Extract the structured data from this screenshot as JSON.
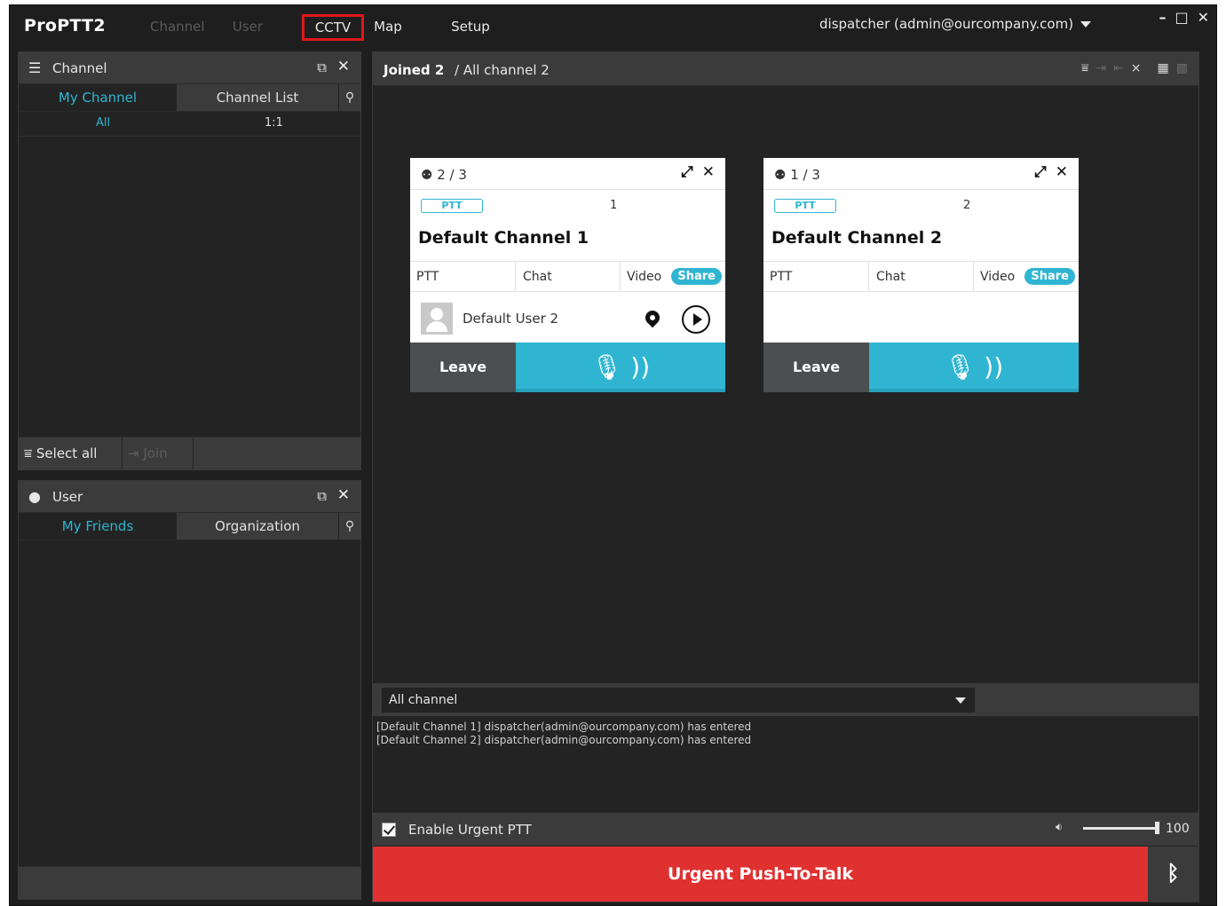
{
  "app": {
    "logo": "ProPTT2",
    "nav": {
      "channel": "Channel",
      "user": "User",
      "cctv": "CCTV",
      "map": "Map",
      "setup": "Setup"
    },
    "account": "dispatcher (admin@ourcompany.com)",
    "window_controls": {
      "minimize": "–",
      "maximize": "□",
      "close": "✕"
    }
  },
  "channel_panel": {
    "title": "Channel",
    "tabs": {
      "my_channel": "My Channel",
      "channel_list": "Channel List"
    },
    "subrow": {
      "all": "All",
      "one_to_one": "1:1"
    },
    "footer": {
      "select_all": "Select all",
      "join": "Join"
    }
  },
  "user_panel": {
    "title": "User",
    "tabs": {
      "my_friends": "My Friends",
      "organization": "Organization"
    }
  },
  "main": {
    "joined_label": "Joined 2",
    "all_channel_label": "/ All channel 2",
    "cards": [
      {
        "count": "2 / 3",
        "badge": "PTT",
        "number": "1",
        "name": "Default Channel 1",
        "modes": {
          "ptt": "PTT",
          "chat": "Chat",
          "video": "Video",
          "share": "Share"
        },
        "member": "Default User 2",
        "leave": "Leave"
      },
      {
        "count": "1 / 3",
        "badge": "PTT",
        "number": "2",
        "name": "Default Channel 2",
        "modes": {
          "ptt": "PTT",
          "chat": "Chat",
          "video": "Video",
          "share": "Share"
        },
        "leave": "Leave"
      }
    ],
    "channel_select": "All channel",
    "log": [
      "[Default Channel 1] dispatcher(admin@ourcompany.com) has entered",
      "[Default Channel 2] dispatcher(admin@ourcompany.com) has entered"
    ],
    "urgent_toggle_label": "Enable Urgent PTT",
    "volume": "100",
    "urgent_button": "Urgent Push-To-Talk"
  },
  "colors": {
    "accent": "#2fb5d2",
    "urgent": "#e03131",
    "highlight_box": "#e0161b",
    "panel_header": "#3b3b3b",
    "background": "#232323"
  },
  "icons": [
    "menu-icon",
    "popout-icon",
    "close-icon",
    "search-icon",
    "user-icon",
    "select-all-icon",
    "join-icon",
    "people-icon",
    "expand-icon",
    "location-pin-icon",
    "play-icon",
    "microphone-icon",
    "speaker-icon",
    "bluetooth-icon",
    "dropdown-icon",
    "checkbox-icon"
  ]
}
